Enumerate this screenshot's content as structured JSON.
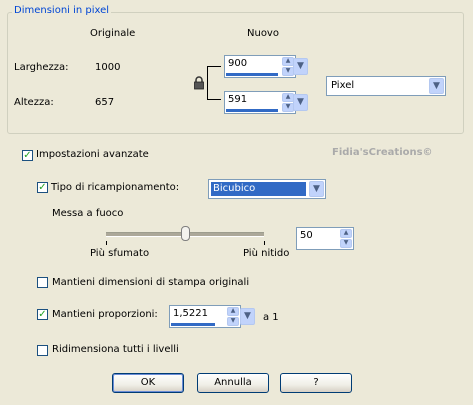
{
  "pixel_group": {
    "title": "Dimensioni in pixel",
    "col_original": "Originale",
    "col_new": "Nuovo",
    "width_label": "Larghezza:",
    "width_original": "1000",
    "width_new": "900",
    "height_label": "Altezza:",
    "height_original": "657",
    "height_new": "591",
    "unit": "Pixel"
  },
  "watermark": "Fidia'sCreations©",
  "advanced": {
    "label": "Impostazioni avanzate",
    "checked": true
  },
  "resample": {
    "label": "Tipo di ricampionamento:",
    "checked": true,
    "value": "Bicubico"
  },
  "sharpen": {
    "label": "Messa a fuoco",
    "min_label": "Più sfumato",
    "max_label": "Più nitido",
    "value": "50"
  },
  "keep_print": {
    "label": "Mantieni dimensioni di stampa originali",
    "checked": false
  },
  "keep_ratio": {
    "label": "Mantieni proporzioni:",
    "checked": true,
    "value": "1,5221",
    "suffix": "a 1"
  },
  "resize_all": {
    "label": "Ridimensiona tutti i livelli",
    "checked": false
  },
  "buttons": {
    "ok": "OK",
    "cancel": "Annulla",
    "help": "?"
  },
  "icons": {
    "lock": "lock-icon",
    "spin": "spin-arrows-icon",
    "dropdown": "chevron-down-icon",
    "check": "check-icon"
  },
  "colors": {
    "group_title": "#0046d5",
    "selection": "#316ac5",
    "watermark": "#aaaaaa"
  }
}
